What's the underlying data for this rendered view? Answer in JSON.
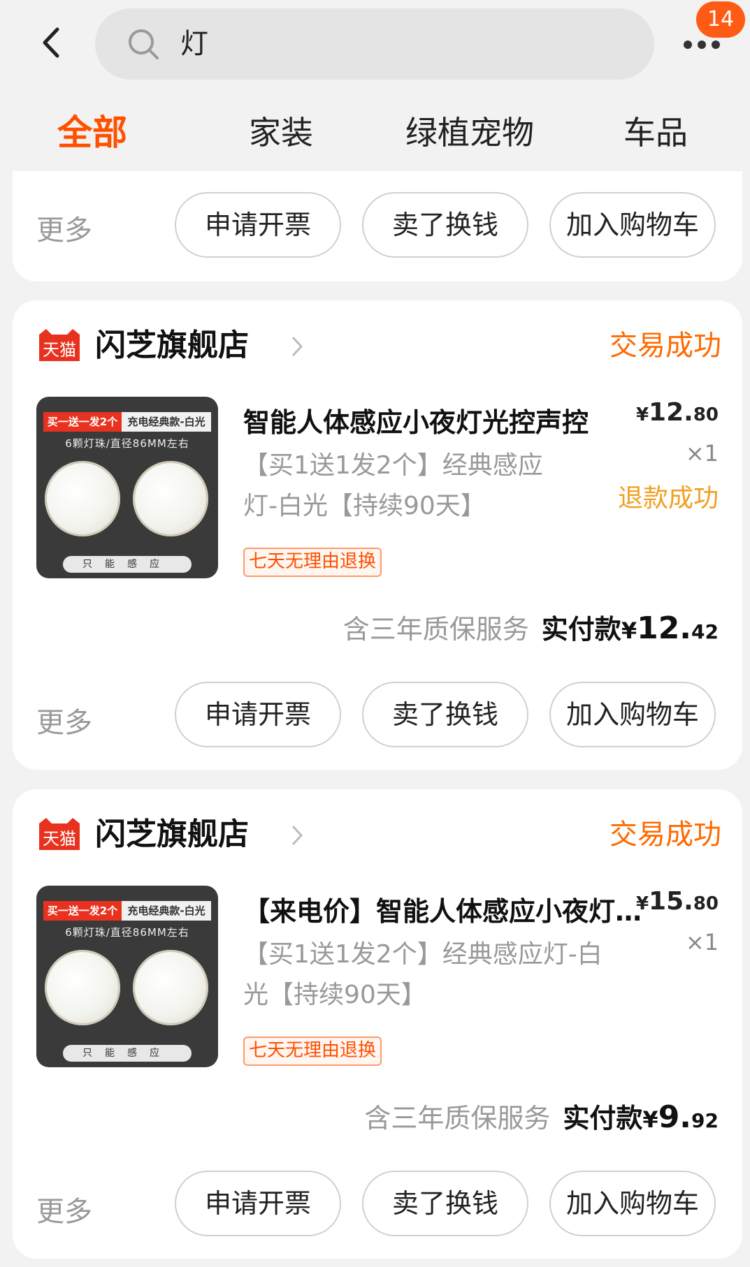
{
  "header": {
    "search_query": "灯",
    "badge_count": "14",
    "tabs": [
      "全部",
      "家装",
      "绿植宠物",
      "车品"
    ]
  },
  "top_card": {
    "more_label": "更多",
    "buttons": [
      "申请开票",
      "卖了换钱",
      "加入购物车"
    ]
  },
  "orders": [
    {
      "shop_name": "闪芝旗舰店",
      "platform_logo_text": "天猫",
      "status": "交易成功",
      "title": "智能人体感应小夜灯光控声控",
      "price_symbol": "¥",
      "price_int": "12.",
      "price_dec": "80",
      "quantity": "×1",
      "refund_status": "退款成功",
      "spec_line1": "【买1送1发2个】经典感应",
      "spec_line2": "灯-白光【持续90天】",
      "tag": "七天无理由退换",
      "service": "含三年质保服务",
      "paid_label": "实付款",
      "paid_symbol": "¥",
      "paid_int": "12.",
      "paid_dec": "42",
      "more_label": "更多",
      "buttons": [
        "申请开票",
        "卖了换钱",
        "加入购物车"
      ],
      "thumb": {
        "banner_red": "买一送一发2个",
        "banner_white": "充电经典款-白光",
        "sub": "6颗灯珠/直径86MM左右",
        "foot": "只能感应"
      }
    },
    {
      "shop_name": "闪芝旗舰店",
      "platform_logo_text": "天猫",
      "status": "交易成功",
      "title": "【来电价】智能人体感应小夜灯光控",
      "price_symbol": "¥",
      "price_int": "15.",
      "price_dec": "80",
      "quantity": "×1",
      "spec_line1": "【买1送1发2个】经典感应灯-白",
      "spec_line2": "光【持续90天】",
      "tag": "七天无理由退换",
      "service": "含三年质保服务",
      "paid_label": "实付款",
      "paid_symbol": "¥",
      "paid_int": "9.",
      "paid_dec": "92",
      "more_label": "更多",
      "buttons": [
        "申请开票",
        "卖了换钱",
        "加入购物车"
      ],
      "thumb": {
        "banner_red": "买一送一发2个",
        "banner_white": "充电经典款-白光",
        "sub": "6颗灯珠/直径86MM左右",
        "foot": "只能感应"
      }
    }
  ],
  "colors": {
    "accent": "#ff5000",
    "refund": "#f0a020",
    "tmall_red": "#e8321f"
  }
}
